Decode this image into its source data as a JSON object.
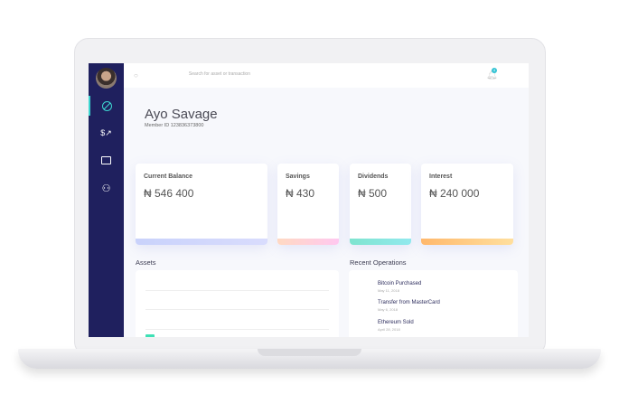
{
  "header": {
    "search_placeholder": "Search for asset or transaction",
    "notification_count": "4"
  },
  "user": {
    "name": "Ayo Savage",
    "member_id": "Member ID 123836373800"
  },
  "cards": [
    {
      "title": "Current Balance",
      "value": "₦ 546 400",
      "gradient": [
        "#c9d2fb",
        "#d9dcfd"
      ]
    },
    {
      "title": "Savings",
      "value": "₦ 430",
      "gradient": [
        "#ffd9c2",
        "#ffc8f0"
      ]
    },
    {
      "title": "Dividends",
      "value": "₦ 500",
      "gradient": [
        "#7fe4cf",
        "#92e9ee"
      ]
    },
    {
      "title": "Interest",
      "value": "₦ 240 000",
      "gradient": [
        "#ffb86c",
        "#ffdf9e"
      ]
    }
  ],
  "assets": {
    "title": "Assets"
  },
  "recent": {
    "title": "Recent Operations",
    "items": [
      {
        "label": "Bitcoin Purchased",
        "date": "May 11, 2018"
      },
      {
        "label": "Transfer from MasterCard",
        "date": "May 6, 2018"
      },
      {
        "label": "Ethereum Sold",
        "date": "April 28, 2018"
      }
    ]
  },
  "colors": {
    "sidebar": "#1f205e",
    "accent": "#3dd6d0"
  }
}
